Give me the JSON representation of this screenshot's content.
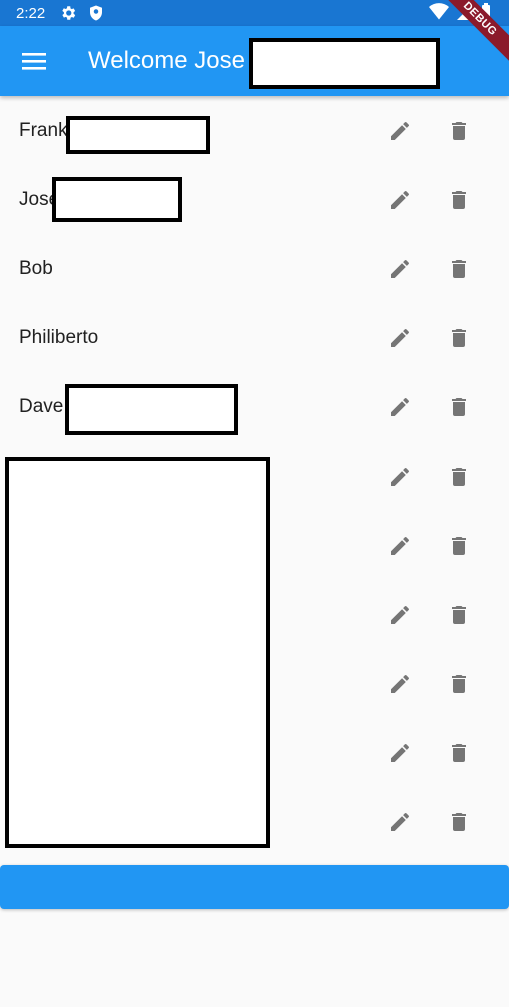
{
  "status_bar": {
    "time": "2:22",
    "debug_label": "DEBUG"
  },
  "app_bar": {
    "title": "Welcome Jose"
  },
  "rows": [
    {
      "name": "Frank"
    },
    {
      "name": "Jose"
    },
    {
      "name": "Bob"
    },
    {
      "name": "Philiberto"
    },
    {
      "name": "Dave"
    },
    {
      "name": ""
    },
    {
      "name": ""
    },
    {
      "name": ""
    },
    {
      "name": ""
    },
    {
      "name": ""
    },
    {
      "name": ""
    }
  ],
  "colors": {
    "primary": "#2196f3",
    "status": "#1976d2",
    "icon": "#757575"
  }
}
